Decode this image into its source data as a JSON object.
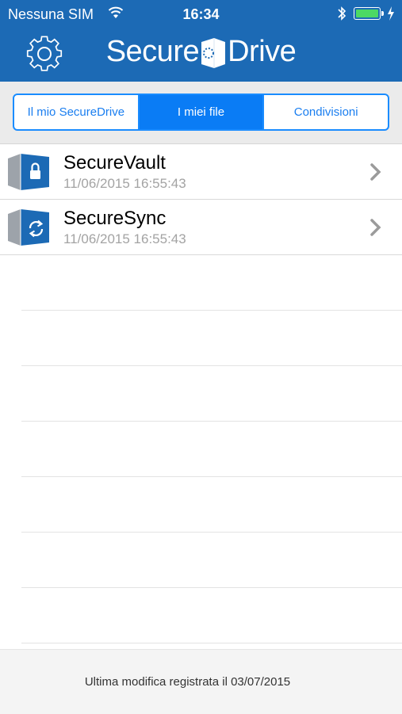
{
  "status": {
    "carrier": "Nessuna SIM",
    "time": "16:34",
    "battery_level": 1.0
  },
  "header": {
    "logo_left": "Secure",
    "logo_right": "Drive",
    "settings_icon": "gear-icon"
  },
  "tabs": [
    {
      "label": "Il mio SecureDrive",
      "active": false
    },
    {
      "label": "I miei file",
      "active": true
    },
    {
      "label": "Condivisioni",
      "active": false
    }
  ],
  "items": [
    {
      "title": "SecureVault",
      "date": "11/06/2015 16:55:43",
      "icon": "vault-lock-icon"
    },
    {
      "title": "SecureSync",
      "date": "11/06/2015 16:55:43",
      "icon": "sync-icon"
    }
  ],
  "footer": {
    "text": "Ultima modifica registrata il 03/07/2015"
  },
  "colors": {
    "header": "#1c6ab5",
    "accent": "#1a8cff",
    "battery": "#4cd964"
  }
}
